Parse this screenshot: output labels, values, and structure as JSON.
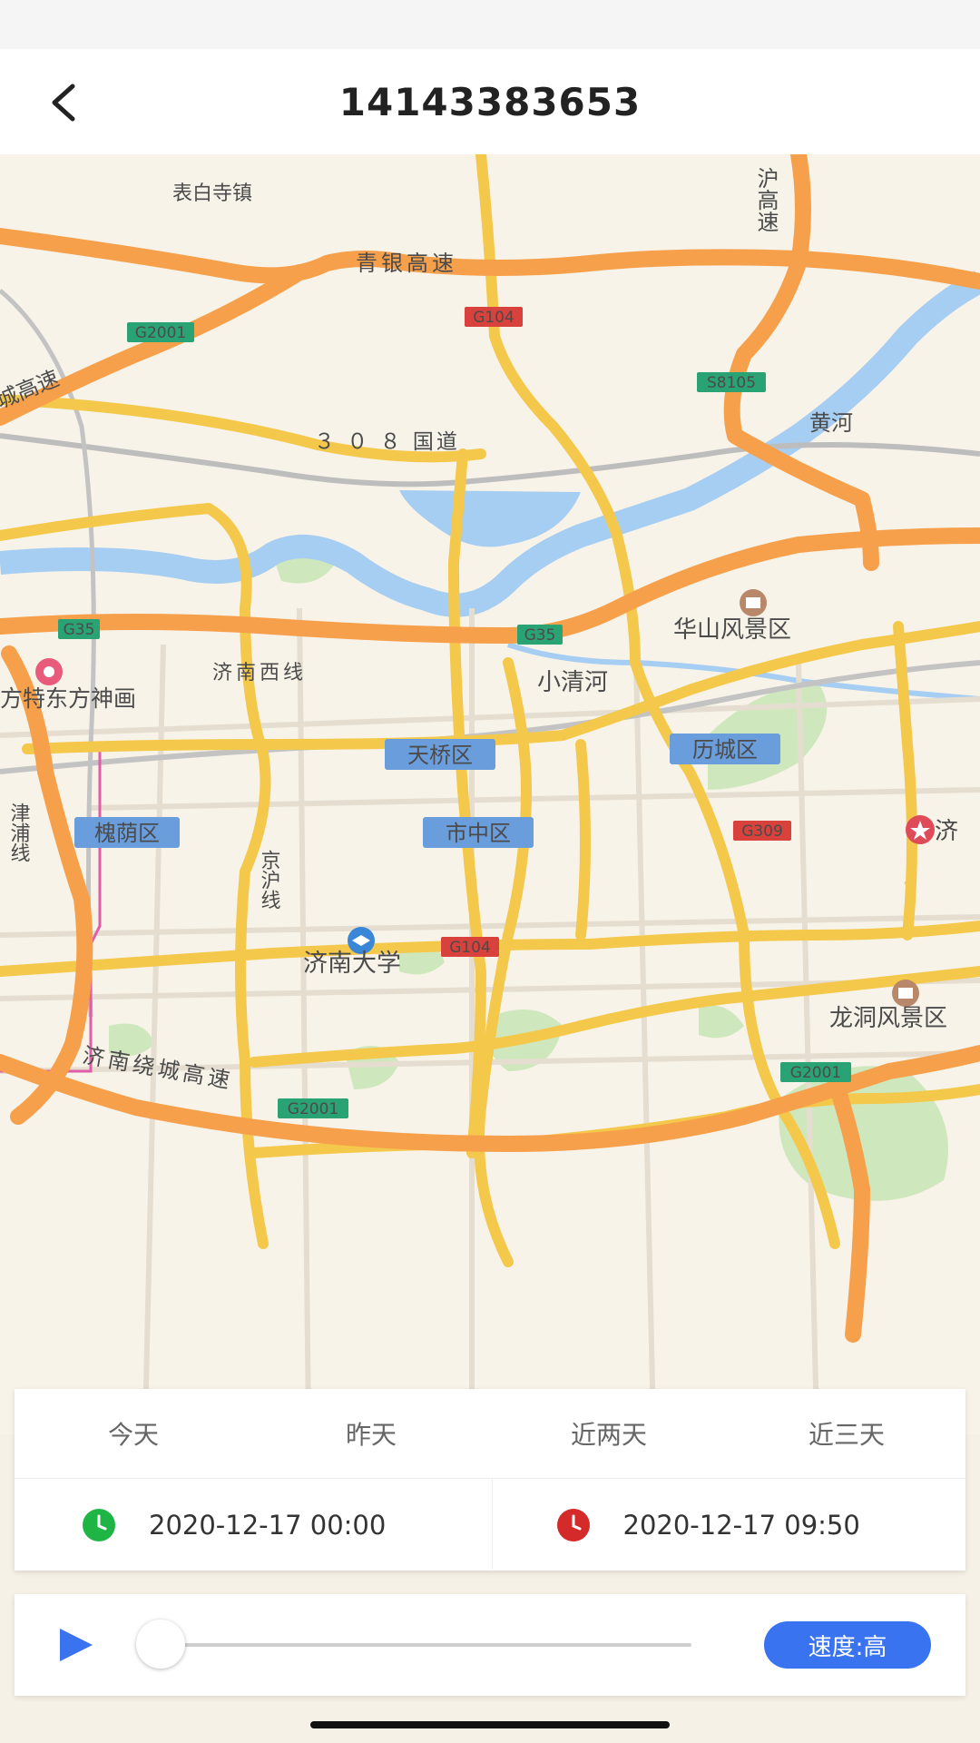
{
  "header": {
    "title": "14143383653"
  },
  "map": {
    "labels": {
      "town_biaobaisi": "表白寺镇",
      "qingyin_expressway": "青银高速",
      "g2001_top": "G2001",
      "g104_top": "G104",
      "s8105": "S8105",
      "hu_expressway": "沪高速",
      "yellow_river": "黄河",
      "national_308": "３ ０ ８ 国道",
      "g35_left": "G35",
      "g35_center": "G35",
      "huashan": "华山风景区",
      "fangte": "方特东方神画",
      "jinanxi_line": "济南西线",
      "xiaoqinghe": "小清河",
      "tianqiao": "天桥区",
      "licheng": "历城区",
      "huaiyin": "槐荫区",
      "shizhong": "市中区",
      "g309": "G309",
      "ji_right": "济",
      "jinghu_line": "京沪线",
      "jinpu_line": "津浦线",
      "g104_bottom": "G104",
      "jinan_university": "济南大学",
      "longdong": "龙洞风景区",
      "ring_expressway": "济南绕城高速",
      "g2001_bottom": "G2001",
      "g2001_right": "G2001",
      "cheng_expressway": "城高速"
    }
  },
  "date_tabs": [
    "今天",
    "昨天",
    "近两天",
    "近三天"
  ],
  "time_range": {
    "start": "2020-12-17 00:00",
    "end": "2020-12-17 09:50",
    "start_color": "#1fb545",
    "end_color": "#d42a2a"
  },
  "player": {
    "speed_label": "速度:高",
    "progress": 0
  },
  "colors": {
    "accent": "#3a73f0",
    "expressway": "#f7a04c",
    "main_road": "#f4c84a",
    "water": "#9ec7f0"
  }
}
